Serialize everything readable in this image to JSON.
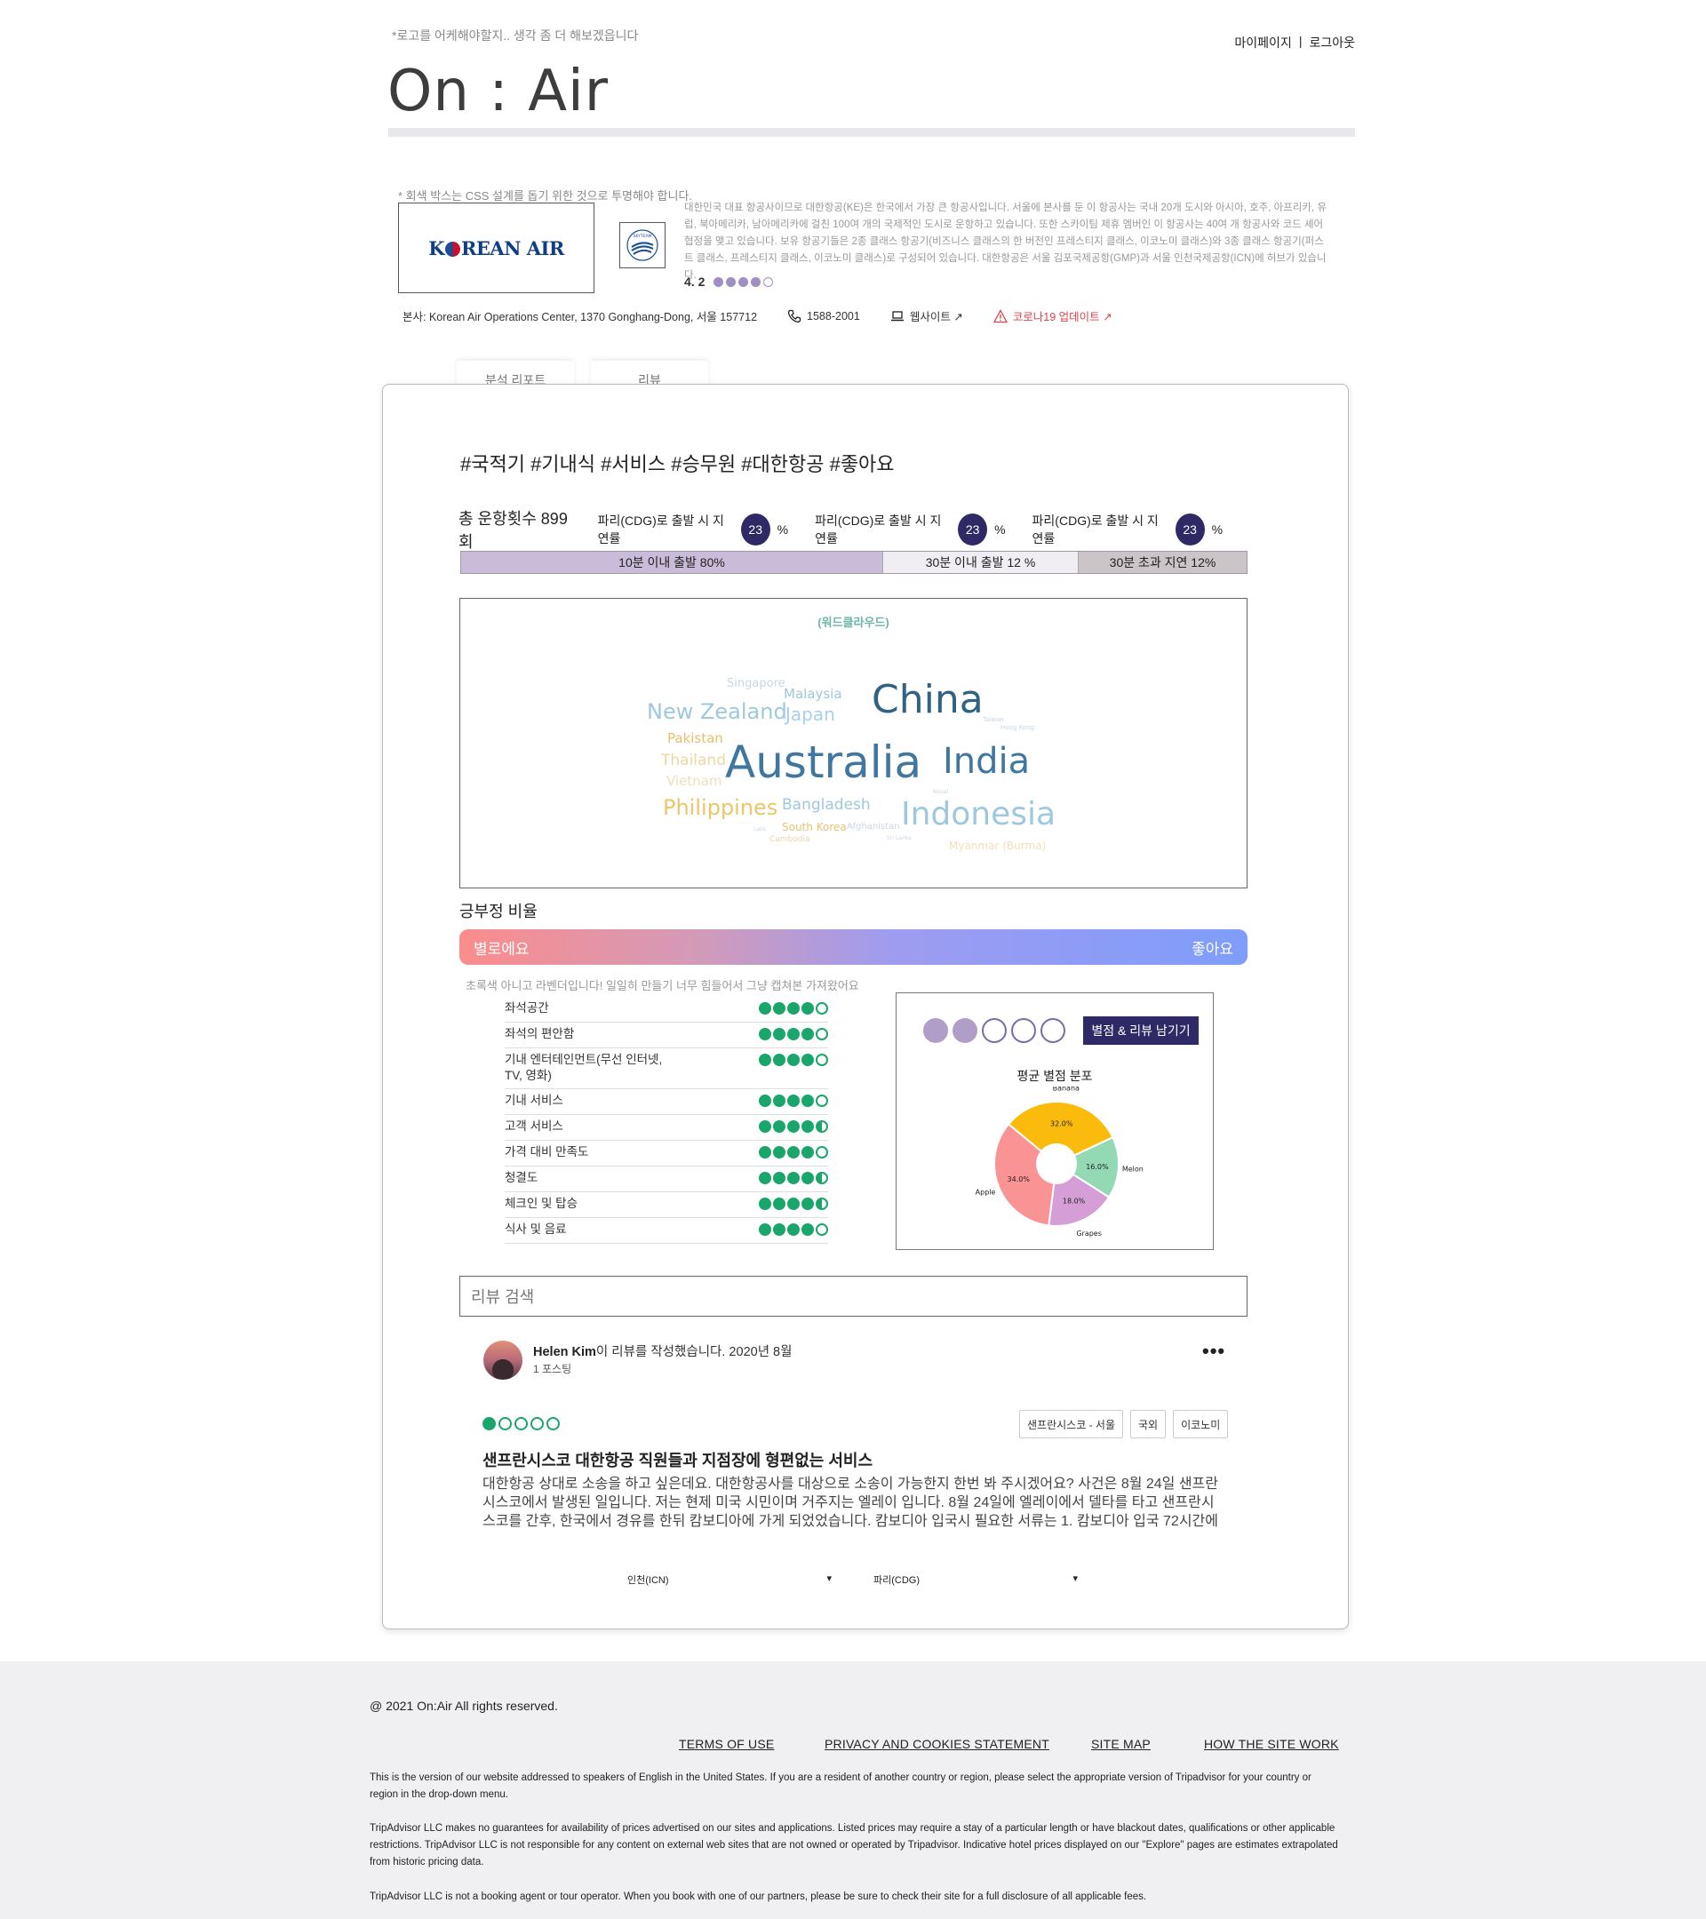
{
  "header": {
    "tagline": "*로고를 어케해야할지.. 생각 좀 더 해보겠읍니다",
    "logo": "On : Air",
    "nav": {
      "mypage": "마이페이지",
      "separator": "|",
      "logout": "로그아웃"
    }
  },
  "airline": {
    "note": "* 회색 박스는 CSS 설계를 돕기 위한 것으로 투명해야 합니다.",
    "logo_text_pre": "K",
    "logo_text_post": "REAN AIR",
    "alliance_icon": "skyteam-icon",
    "description": "대한민국 대표 항공사이므로 대한항공(KE)은 한국에서 가장 큰 항공사입니다. 서울에 본사를 둔 이 항공사는 국내 20개 도시와 아시아, 호주, 아프리카, 유럽, 북아메리카, 남아메리카에 걸친 100여 개의 국제적인 도시로 운항하고 있습니다. 또한 스카이팀 제휴 멤버인 이 항공사는 40여 개 항공사와 코드 셰어 협정을 맺고 있습니다. 보유 항공기들은 2종 클래스 항공기(비즈니스 클래스의 한 버전인 프레스티지 클래스, 이코노미 클래스)와 3종 클래스 항공기(퍼스트 클래스, 프레스티지 클래스, 이코노미 클래스)로 구성되어 있습니다. 대한항공은 서울 김포국제공항(GMP)과 서울 인천국제공항(ICN)에 허브가 있습니다.",
    "rating": "4. 2",
    "rating_value": 4.2,
    "rating_color": "#a08fc4",
    "address": "본사: Korean Air Operations Center, 1370 Gonghang-Dong, 서울 157712",
    "phone": "1588-2001",
    "website": "웹사이트 ↗",
    "covid": "코로나19 업데이트 ↗",
    "covid_color": "#e0424a"
  },
  "tabs": [
    {
      "label": "분석 리포트"
    },
    {
      "label": "리뷰"
    }
  ],
  "report": {
    "hashtags": "#국적기 #기내식 #서비스 #승무원 #대한항공 #좋아요",
    "total": "총 운항횟수 899회",
    "stats": [
      {
        "label": "파리(CDG)로 출발 시 지연률",
        "value": "23",
        "unit": "%"
      },
      {
        "label": "파리(CDG)로 출발 시 지연률",
        "value": "23",
        "unit": "%"
      },
      {
        "label": "파리(CDG)로 출발 시 지연률",
        "value": "23",
        "unit": "%"
      }
    ],
    "delay_bar": [
      {
        "label": "10분 이내 출발 80%"
      },
      {
        "label": "30분 이내 출발 12 %"
      },
      {
        "label": "30분 초과 지연 12%"
      }
    ],
    "wordcloud_title": "(워드클라우드)",
    "words": [
      "Singapore",
      "Malaysia",
      "New Zealand",
      "Japan",
      "China",
      "Pakistan",
      "Thailand",
      "Australia",
      "India",
      "Vietnam",
      "Philippines",
      "Bangladesh",
      "Indonesia",
      "South Korea",
      "Afghanistan",
      "Cambodia",
      "Myanmar (Burma)",
      "Taiwan",
      "Hong Kong",
      "Laos",
      "Nepal",
      "Sri Lanka"
    ]
  },
  "sentiment": {
    "title": "긍부정 비율",
    "bad": "별로에요",
    "good": "좋아요",
    "note": "초록색 아니고 라벤더입니다! 일일히 만들기 너무 힘들어서 그냥 캡쳐본 가져왔어요",
    "criteria": [
      {
        "label": "좌석공간",
        "score": 4
      },
      {
        "label": "좌석의 편안함",
        "score": 4
      },
      {
        "label": "기내 엔터테인먼트(무선 인터넷, TV, 영화)",
        "score": 4
      },
      {
        "label": "기내 서비스",
        "score": 4
      },
      {
        "label": "고객 서비스",
        "score": 4.5
      },
      {
        "label": "가격 대비 만족도",
        "score": 4
      },
      {
        "label": "청결도",
        "score": 4.5
      },
      {
        "label": "체크인 및 탑승",
        "score": 4.5
      },
      {
        "label": "식사 및 음료",
        "score": 4
      }
    ]
  },
  "rate_widget": {
    "filled": 2,
    "total": 5,
    "button": "별점 & 리뷰 남기기",
    "chart_title": "평균 별점 분포"
  },
  "chart_data": {
    "type": "pie",
    "title": "평균 별점 분포",
    "categories": [
      "Banana",
      "Melon",
      "Grapes",
      "Apple"
    ],
    "values": [
      32.0,
      16.0,
      18.0,
      34.0
    ],
    "labels": [
      "32.0%",
      "16.0%",
      "18.0%",
      "34.0%"
    ],
    "colors": [
      "#fbbb0c",
      "#92d9b4",
      "#d69ed6",
      "#fa9393"
    ],
    "donut": true
  },
  "review_search": {
    "placeholder": "리뷰 검색"
  },
  "review": {
    "user": "Helen Kim",
    "action": "이 리뷰를 작성했습니다. 2020년 8월",
    "posts": "1 포스팅",
    "more": "•••",
    "rating": 1,
    "tags": [
      "샌프란시스코 - 서울",
      "국외",
      "이코노미"
    ],
    "title": "샌프란시스코 대한항공 직원들과 지점장에 형편없는 서비스",
    "body": "대한항공 상대로 소송을 하고 싶은데요. 대한항공사를 대상으로 소송이 가능한지 한번 봐 주시겠어요? 사건은 8월 24일 샌프란시스코에서 발생된 일입니다. 저는 현제 미국 시민이며 거주지는 엘레이 입니다. 8월 24일에 엘레이에서 델타를 타고 샌프란시스코를 간후, 한국에서 경유를 한뒤 캄보디아에 가게 되었었습니다. 캄보디아 입국시 필요한 서류는 1. 캄보디아 입국 72시간에"
  },
  "route_select": {
    "from": "인천(ICN)",
    "to": "파리(CDG)",
    "arrow": "▾"
  },
  "footer": {
    "copyright": "@ 2021 On:Air All rights reserved.",
    "links": [
      "TERMS OF USE",
      "PRIVACY AND COOKIES STATEMENT",
      "SITE MAP",
      "HOW THE SITE WORK"
    ],
    "p1": "This is the version of our website addressed to speakers of English in the United States. If you are a resident of another country or region, please select the appropriate version of Tripadvisor for your country or region in the drop-down menu.",
    "p2": "TripAdvisor LLC makes no guarantees for availability of prices advertised on our sites and applications. Listed prices may require a stay of a particular length or have blackout dates, qualifications or other applicable restrictions. TripAdvisor LLC is not responsible for any content on external web sites that are not owned or operated by Tripadvisor. Indicative hotel prices displayed on our \"Explore\" pages are estimates extrapolated from historic pricing data.",
    "p3": "TripAdvisor LLC is not a booking agent or tour operator. When you book with one of our partners, please be sure to check their site for a full disclosure of all applicable fees."
  }
}
